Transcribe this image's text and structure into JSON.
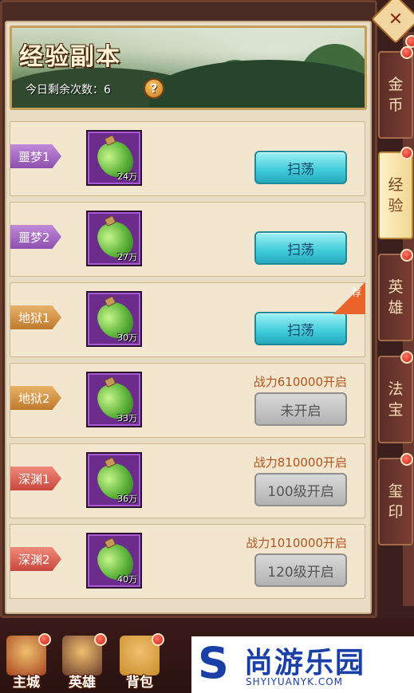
{
  "banner": {
    "title": "经验副本",
    "remaining_label": "今日剩余次数：6"
  },
  "help_icon_glyph": "?",
  "close_glyph": "✕",
  "rows": [
    {
      "tag": "噩梦1",
      "tag_color": "purple",
      "qty": "24万",
      "button": "扫荡",
      "button_state": "sweep",
      "requirement": "",
      "recommended": false
    },
    {
      "tag": "噩梦2",
      "tag_color": "purple",
      "qty": "27万",
      "button": "扫荡",
      "button_state": "sweep",
      "requirement": "",
      "recommended": false
    },
    {
      "tag": "地狱1",
      "tag_color": "orange",
      "qty": "30万",
      "button": "扫荡",
      "button_state": "sweep",
      "requirement": "",
      "recommended": true,
      "recommended_label": "荐"
    },
    {
      "tag": "地狱2",
      "tag_color": "orange",
      "qty": "33万",
      "button": "未开启",
      "button_state": "locked",
      "requirement": "战力610000开启",
      "recommended": false
    },
    {
      "tag": "深渊1",
      "tag_color": "red",
      "qty": "36万",
      "button": "100级开启",
      "button_state": "locked",
      "requirement": "战力810000开启",
      "recommended": false
    },
    {
      "tag": "深渊2",
      "tag_color": "red",
      "qty": "40万",
      "button": "120级开启",
      "button_state": "locked",
      "requirement": "战力1010000开启",
      "recommended": false
    }
  ],
  "side_tabs": [
    {
      "label_top": "金",
      "label_bottom": "币",
      "active": false
    },
    {
      "label_top": "经",
      "label_bottom": "验",
      "active": true
    },
    {
      "label_top": "英",
      "label_bottom": "雄",
      "active": false
    },
    {
      "label_top": "法",
      "label_bottom": "宝",
      "active": false
    },
    {
      "label_top": "玺",
      "label_bottom": "印",
      "active": false
    }
  ],
  "bottom_nav": [
    {
      "label": "主城",
      "icon": "city-icon"
    },
    {
      "label": "英雄",
      "icon": "hero-icon"
    },
    {
      "label": "背包",
      "icon": "bag-icon"
    }
  ],
  "watermark": {
    "logo": "S",
    "name_cn": "尚游乐园",
    "name_en": "SHYIYUANYK.COM"
  },
  "colors": {
    "sweep_button": "#3fcbd9",
    "locked_button": "#b2b2b2",
    "requirement_text": "#b2541c",
    "tag_purple": "#a56cc8",
    "tag_orange": "#d6953f",
    "tag_red": "#dc5c50"
  }
}
